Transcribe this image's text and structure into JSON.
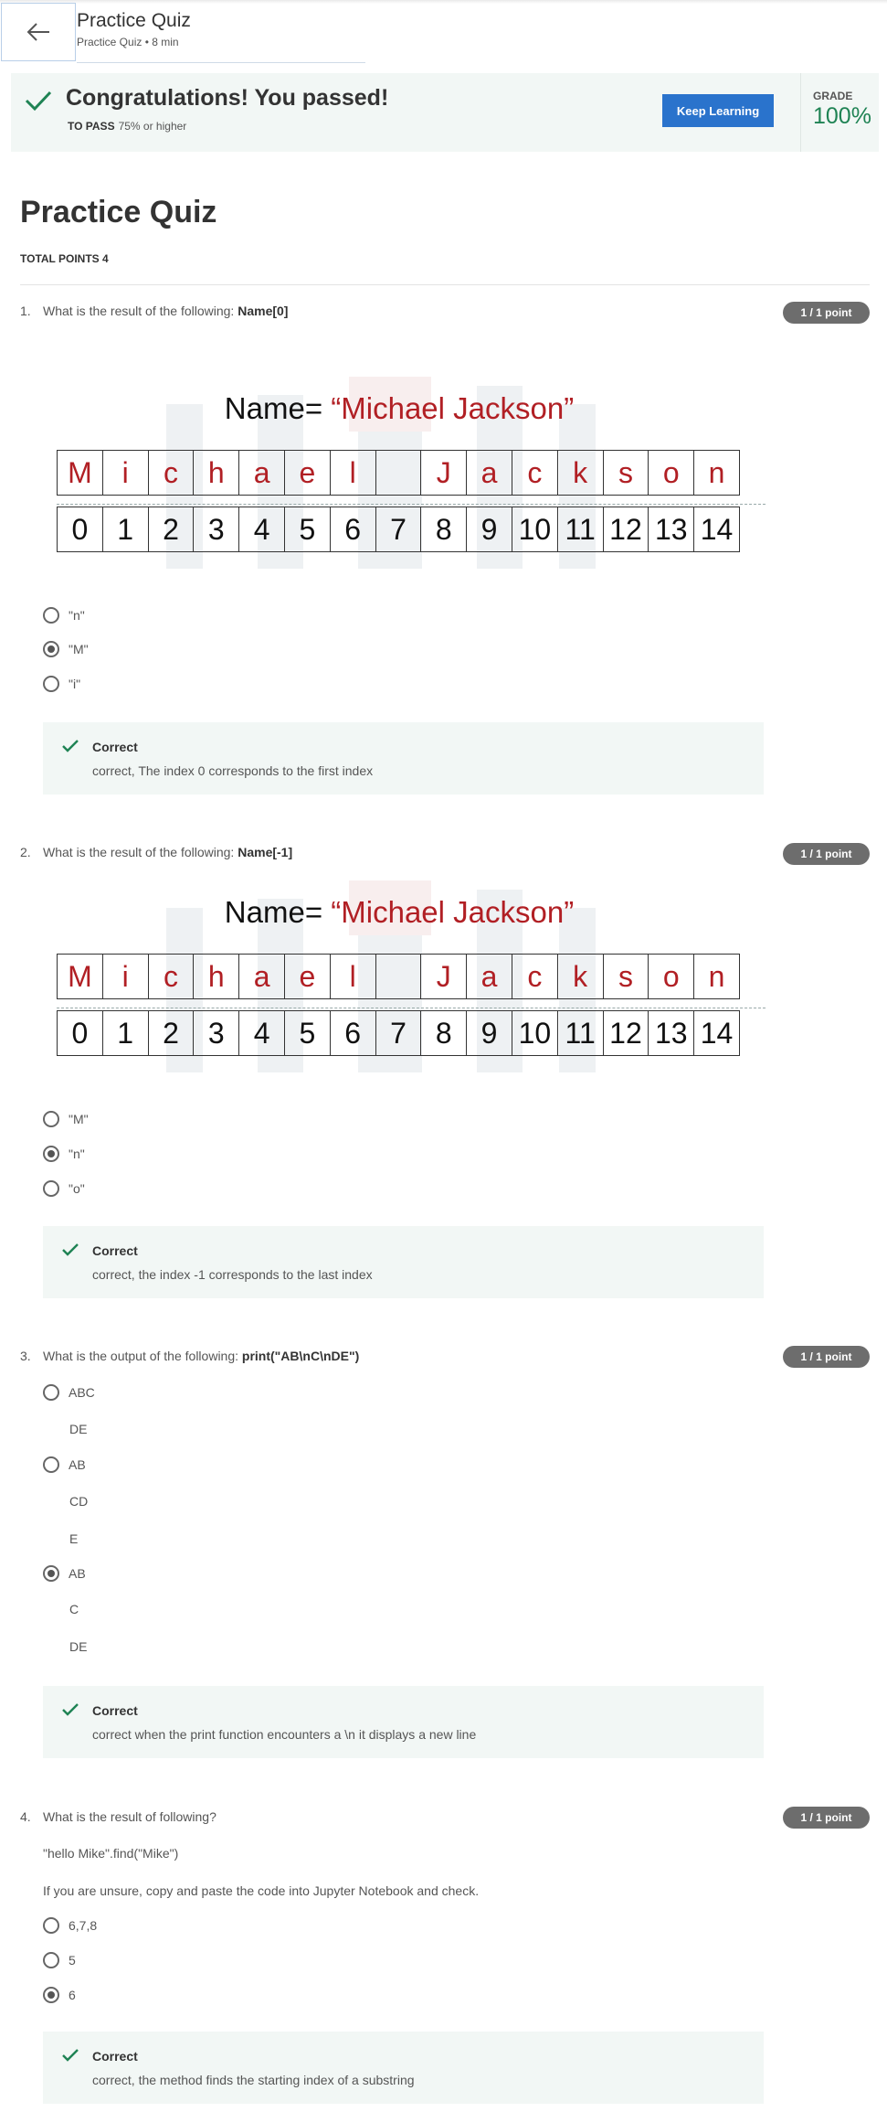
{
  "header": {
    "title": "Practice Quiz",
    "subtitle": "Practice Quiz • 8 min"
  },
  "banner": {
    "message": "Congratulations! You passed!",
    "to_pass_label": "TO PASS",
    "to_pass_value": "75% or higher",
    "button": "Keep Learning",
    "grade_label": "GRADE",
    "grade_value": "100%"
  },
  "page": {
    "title": "Practice Quiz",
    "total_points": "TOTAL POINTS 4"
  },
  "figure": {
    "title_prefix": "Name=",
    "title_value": "“Michael Jackson”",
    "chars": [
      "M",
      "i",
      "c",
      "h",
      "a",
      "e",
      "l",
      "",
      "J",
      "a",
      "c",
      "k",
      "s",
      "o",
      "n"
    ],
    "indices": [
      "0",
      "1",
      "2",
      "3",
      "4",
      "5",
      "6",
      "7",
      "8",
      "9",
      "10",
      "11",
      "12",
      "13",
      "14"
    ]
  },
  "questions": [
    {
      "number": "1.",
      "prompt": "What is the result of the following:",
      "prompt_code": "Name[0]",
      "points": "1 / 1 point",
      "options": [
        "\"n\"",
        "\"M\"",
        "\"i\""
      ],
      "selected": 1,
      "feedback_title": "Correct",
      "feedback_text": "correct, The index 0 corresponds to the first index"
    },
    {
      "number": "2.",
      "prompt": "What is the result of the following:",
      "prompt_code": "Name[-1]",
      "points": "1 / 1 point",
      "options": [
        "\"M\"",
        "\"n\"",
        "\"o\""
      ],
      "selected": 1,
      "feedback_title": "Correct",
      "feedback_text": "correct, the index -1 corresponds to the last index"
    },
    {
      "number": "3.",
      "prompt": "What is the output of the following:",
      "prompt_code": "print(\"AB\\nC\\nDE\")",
      "points": "1 / 1 point",
      "options": [
        {
          "label": "ABC",
          "extra": [
            "DE"
          ]
        },
        {
          "label": "AB",
          "extra": [
            "CD",
            "E"
          ]
        },
        {
          "label": "AB",
          "extra": [
            "C",
            "DE"
          ]
        }
      ],
      "selected": 2,
      "feedback_title": "Correct",
      "feedback_text": "correct when the print function encounters a \\n it displays a new line"
    },
    {
      "number": "4.",
      "prompt": "What is the result of following?",
      "code_line": "\"hello Mike\".find(\"Mike\")",
      "hint": "If you are unsure, copy and paste the code into Jupyter Notebook and check.",
      "points": "1 / 1 point",
      "options": [
        "6,7,8",
        "5",
        "6"
      ],
      "selected": 2,
      "feedback_title": "Correct",
      "feedback_text": "correct, the method finds the starting index of a substring"
    }
  ]
}
